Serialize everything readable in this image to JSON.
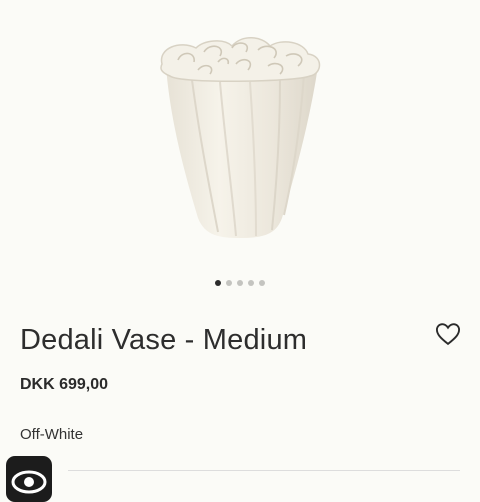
{
  "product": {
    "title": "Dedali Vase - Medium",
    "price": "DKK 699,00",
    "color": "Off-White"
  },
  "gallery": {
    "slide_count": 5,
    "active_index": 0,
    "image_icon": "vase-image"
  },
  "actions": {
    "wishlist_icon": "heart-outline-icon",
    "accessibility_icon": "eye-icon"
  },
  "colors": {
    "background": "#fbfbf7",
    "vase": "#f1ede3",
    "text": "#2d2d2d"
  }
}
